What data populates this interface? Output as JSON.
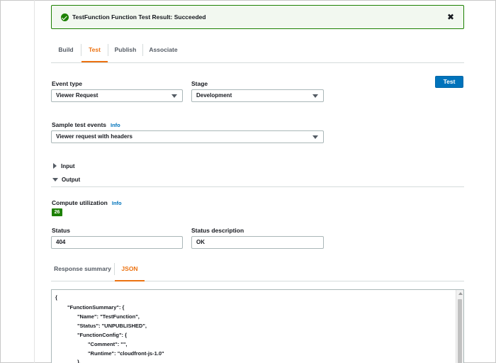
{
  "banner": {
    "message": "TestFunction Function Test Result: Succeeded",
    "close": "✖"
  },
  "tabs": [
    {
      "label": "Build"
    },
    {
      "label": "Test"
    },
    {
      "label": "Publish"
    },
    {
      "label": "Associate"
    }
  ],
  "form": {
    "event_type_label": "Event type",
    "event_type_value": "Viewer Request",
    "stage_label": "Stage",
    "stage_value": "Development",
    "test_button": "Test",
    "sample_label": "Sample test events",
    "sample_info": "Info",
    "sample_value": "Viewer request with headers"
  },
  "sections": {
    "input": "Input",
    "output": "Output"
  },
  "output": {
    "compute_label": "Compute utilization",
    "compute_info": "Info",
    "compute_value": "26",
    "status_label": "Status",
    "status_value": "404",
    "status_desc_label": "Status description",
    "status_desc_value": "OK"
  },
  "result_tabs": [
    {
      "label": "Response summary"
    },
    {
      "label": "JSON"
    }
  ],
  "json_lines": [
    "{",
    "\"FunctionSummary\": {",
    "\"Name\": \"TestFunction\",",
    "\"Status\": \"UNPUBLISHED\",",
    "\"FunctionConfig\": {",
    "\"Comment\": \"\",",
    "\"Runtime\": \"cloudfront-js-1.0\"",
    "},"
  ],
  "colors": {
    "success": "#1d8102",
    "accent": "#ec7211",
    "primary": "#0073bb"
  }
}
